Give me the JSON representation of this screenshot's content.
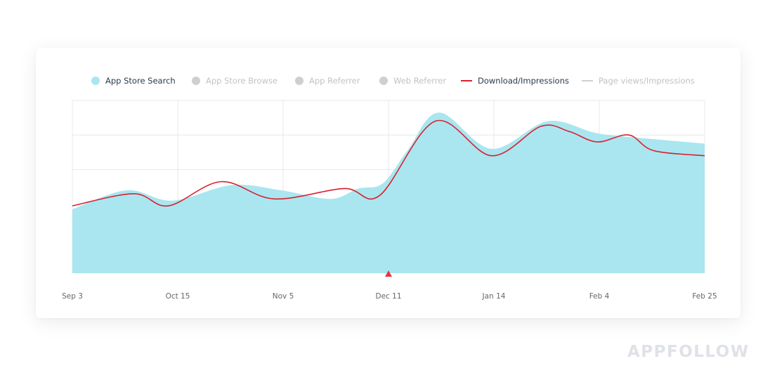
{
  "legend": {
    "items": [
      {
        "label": "App Store Search",
        "type": "dot",
        "color": "#a9e6f0",
        "active": true
      },
      {
        "label": "App Store Browse",
        "type": "dot",
        "color": "#cfcfcf",
        "active": false
      },
      {
        "label": "App Referrer",
        "type": "dot",
        "color": "#cfcfcf",
        "active": false
      },
      {
        "label": "Web Referrer",
        "type": "dot",
        "color": "#cfcfcf",
        "active": false
      },
      {
        "label": "Download/Impressions",
        "type": "line",
        "color": "#d9212e",
        "active": true
      },
      {
        "label": "Page views/Impressions",
        "type": "line",
        "color": "#cfcfcf",
        "active": false
      }
    ]
  },
  "watermark": "APPFOLLOW",
  "chart_data": {
    "type": "area",
    "title": "",
    "xlabel": "",
    "ylabel": "",
    "x_ticks": [
      "Sep 3",
      "Oct 15",
      "Nov 5",
      "Dec 11",
      "Jan 14",
      "Feb 4",
      "Feb 25"
    ],
    "xlim": [
      0,
      1
    ],
    "ylim": [
      0,
      100
    ],
    "y_note": "no y-axis labels shown; values normalized 0-100",
    "grid": true,
    "legend_position": "top",
    "marker": {
      "label": "event-marker",
      "x": 0.5,
      "color": "#e8333f"
    },
    "series": [
      {
        "name": "App Store Search",
        "type": "area",
        "color": "#a9e6f0",
        "x": [
          0,
          0.086,
          0.158,
          0.252,
          0.33,
          0.408,
          0.452,
          0.491,
          0.53,
          0.58,
          0.663,
          0.752,
          0.83,
          0.908,
          1.0
        ],
        "values": [
          37,
          48,
          42,
          51,
          48,
          43,
          49,
          52,
          71,
          93,
          72,
          88,
          81,
          78,
          75
        ]
      },
      {
        "name": "Download/Impressions",
        "type": "line",
        "color": "#d9212e",
        "x": [
          0,
          0.097,
          0.152,
          0.235,
          0.319,
          0.43,
          0.486,
          0.574,
          0.663,
          0.741,
          0.786,
          0.83,
          0.88,
          0.919,
          1.0
        ],
        "values": [
          39,
          46,
          39,
          53,
          43,
          49,
          45,
          88,
          68,
          85,
          82,
          76,
          80,
          71,
          68
        ]
      }
    ]
  }
}
